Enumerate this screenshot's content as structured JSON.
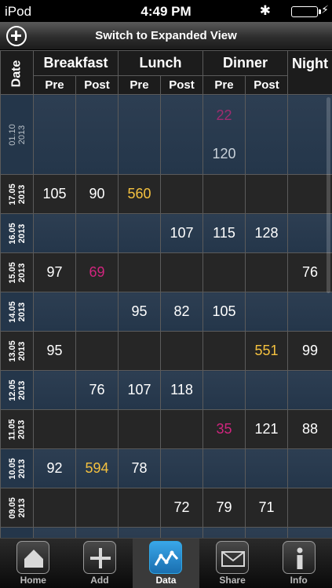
{
  "status": {
    "carrier": "iPod",
    "time": "4:49 PM"
  },
  "toolbar": {
    "title": "Switch to Expanded View"
  },
  "header": {
    "date_label": "Date",
    "meals": [
      "Breakfast",
      "Lunch",
      "Dinner",
      "Night"
    ],
    "pre": "Pre",
    "post": "Post"
  },
  "rows": [
    {
      "date_top": "01.10",
      "date_bottom": "2013",
      "dinner_pre_a": "22",
      "dinner_pre_b": "120"
    },
    {
      "date_top": "17.05",
      "date_bottom": "2013",
      "b_pre": "105",
      "b_post": "90",
      "l_pre": "560"
    },
    {
      "date_top": "16.05",
      "date_bottom": "2013",
      "l_post": "107",
      "d_pre": "115",
      "d_post": "128"
    },
    {
      "date_top": "15.05",
      "date_bottom": "2013",
      "b_pre": "97",
      "b_post": "69",
      "night": "76"
    },
    {
      "date_top": "14.05",
      "date_bottom": "2013",
      "l_pre": "95",
      "l_post": "82",
      "d_pre": "105"
    },
    {
      "date_top": "13.05",
      "date_bottom": "2013",
      "b_pre": "95",
      "d_post": "551",
      "night": "99"
    },
    {
      "date_top": "12.05",
      "date_bottom": "2013",
      "b_post": "76",
      "l_pre": "107",
      "l_post": "118"
    },
    {
      "date_top": "11.05",
      "date_bottom": "2013",
      "d_pre": "35",
      "d_post": "121",
      "night": "88"
    },
    {
      "date_top": "10.05",
      "date_bottom": "2013",
      "b_pre": "92",
      "b_post": "594",
      "l_pre": "78"
    },
    {
      "date_top": "09.05",
      "date_bottom": "2013",
      "l_post": "72",
      "d_pre": "79",
      "d_post": "71"
    }
  ],
  "tabs": [
    {
      "label": "Home",
      "icon": "home-icon"
    },
    {
      "label": "Add",
      "icon": "plus-icon"
    },
    {
      "label": "Data",
      "icon": "chart-icon",
      "active": true
    },
    {
      "label": "Share",
      "icon": "envelope-icon"
    },
    {
      "label": "Info",
      "icon": "info-icon"
    }
  ],
  "colors": {
    "high": "#f4c13f",
    "low": "#d1257e",
    "active_tab": "#2fa6e4"
  }
}
